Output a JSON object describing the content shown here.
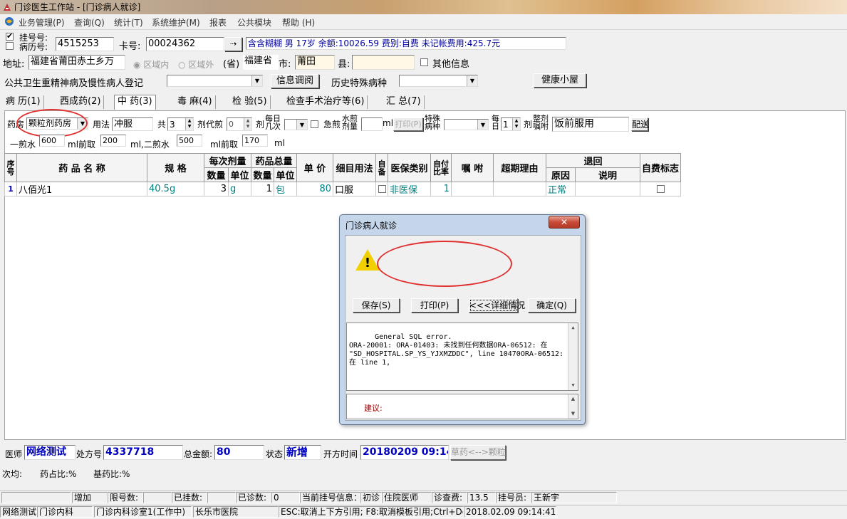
{
  "window": {
    "title": "门诊医生工作站 - [门诊病人就诊]"
  },
  "menu": [
    "业务管理(P)",
    "查询(Q)",
    "统计(T)",
    "系统维护(M)",
    "报表",
    "公共模块",
    "帮助 (H)"
  ],
  "patient": {
    "reg_label": "挂号号:",
    "record_label": "病历号:",
    "record_no": "4515253",
    "card_label": "卡号:",
    "card_no": "00024362",
    "info": "含含糊糊 男 17岁 余额:10026.59 费别:自费 未记帐费用:425.7元",
    "addr_label": "地址:",
    "addr": "福建省莆田赤土乡万",
    "in_area": "区域内",
    "out_area": "区域外",
    "province_label": "(省)",
    "province": "福建省",
    "city_label": "市:",
    "city": "莆田",
    "county_label": "县:",
    "county": "",
    "other_info": "其他信息",
    "chronic_label": "公共卫生重精神病及慢性病人登记",
    "info_query": "信息调阅",
    "history_label": "历史特殊病种",
    "health_house": "健康小屋"
  },
  "tabs": [
    "病 历(1)",
    "西成药(2)",
    "中 药(3)",
    "毒 麻(4)",
    "检 验(5)",
    "检查手术治疗等(6)",
    "汇 总(7)"
  ],
  "herb": {
    "pharmacy_label": "药房",
    "pharmacy": "颗粒剂药房",
    "usage_label": "用法",
    "usage": "冲服",
    "total_label": "共",
    "total": "3",
    "dose_unit": "剂",
    "decoct_label": "剂代煎",
    "decoct": "0",
    "dose_unit2": "剂",
    "daily_label": "每日几次",
    "urgent_label": "急煎",
    "water_label": "水煎剂量",
    "ml": "ml",
    "print_btn": "打印(P)",
    "special_label": "特殊病种",
    "per_day_label": "每日",
    "per_day": "1",
    "dose_unit3": "剂",
    "instruct_label": "整剂嘱咐",
    "instruct": "饭前服用",
    "dispense": "配送",
    "first_water_label": "一煎水",
    "first_water": "600",
    "first_take_label": "ml前取",
    "first_take": "200",
    "second_water_label": "ml,二煎水",
    "second_water": "500",
    "second_take_label": "ml前取",
    "second_take": "170",
    "ml_end": "ml"
  },
  "grid": {
    "headers": {
      "seq": "序号",
      "name": "药 品 名 称",
      "spec": "规  格",
      "per_dose": "每次剂量",
      "total": "药品总量",
      "qty": "数量",
      "unit": "单位",
      "price": "单 价",
      "usage": "细目用法",
      "self": "自备",
      "insurance": "医保类别",
      "ratio": "自付比率",
      "note": "嘱 咐",
      "reason": "超期理由",
      "refund": "退回",
      "refund_reason": "原因",
      "refund_desc": "说明",
      "selfpay": "自费标志"
    },
    "rows": [
      {
        "seq": "1",
        "name": "八佰光1",
        "spec": "40.5g",
        "dose_qty": "3",
        "dose_unit": "g",
        "total_qty": "1",
        "total_unit": "包",
        "price": "80",
        "usage": "口服",
        "insurance": "非医保",
        "ratio": "1",
        "note": "",
        "reason": "",
        "refund_reason": "正常",
        "refund_desc": ""
      }
    ]
  },
  "dialog": {
    "title": "门诊病人就诊",
    "close": "✕",
    "buttons": [
      "保存(S)",
      "打印(P)",
      "<<<详细情况",
      "确定(Q)"
    ],
    "error": "General SQL error.\nORA-20001: ORA-01403: 未找到任何数据ORA-06512: 在 \"SD_HOSPITAL.SP_YS_YJXMZDDC\", line 10470ORA-06512: 在 line 1,",
    "suggest_label": "建议:"
  },
  "footer": {
    "doctor_label": "医师",
    "doctor": "网络测试",
    "rx_label": "处方号",
    "rx": "4337718",
    "amount_label": "总金额:",
    "amount": "80",
    "state_label": "状态",
    "state": "新增",
    "time_label": "开方时间",
    "time": "20180209 09:14",
    "switch_btn": "草药<-->颗粒",
    "times_label": "次均:",
    "drug_ratio": "药占比:%",
    "base_ratio": "基药比:%"
  },
  "status1": [
    "",
    "增加",
    "限号数:",
    "",
    "已挂数:",
    "",
    "已诊数:",
    "0",
    "当前挂号信息：",
    "初诊",
    "住院医师",
    "诊查费:",
    "13.5",
    "挂号员:",
    "王新宇"
  ],
  "status2": [
    "网络测试",
    "门诊内科",
    "门诊内科诊室1(工作中)",
    "长乐市医院",
    "ESC:取消上下方引用; F8:取消模板引用;Ctrl+Del",
    "2018.02.09 09:14:41"
  ],
  "colors": {
    "accent_red": "#e03030",
    "teal": "#008080",
    "blue": "#0000c0",
    "dialog_frame": "#c5d6ea"
  }
}
